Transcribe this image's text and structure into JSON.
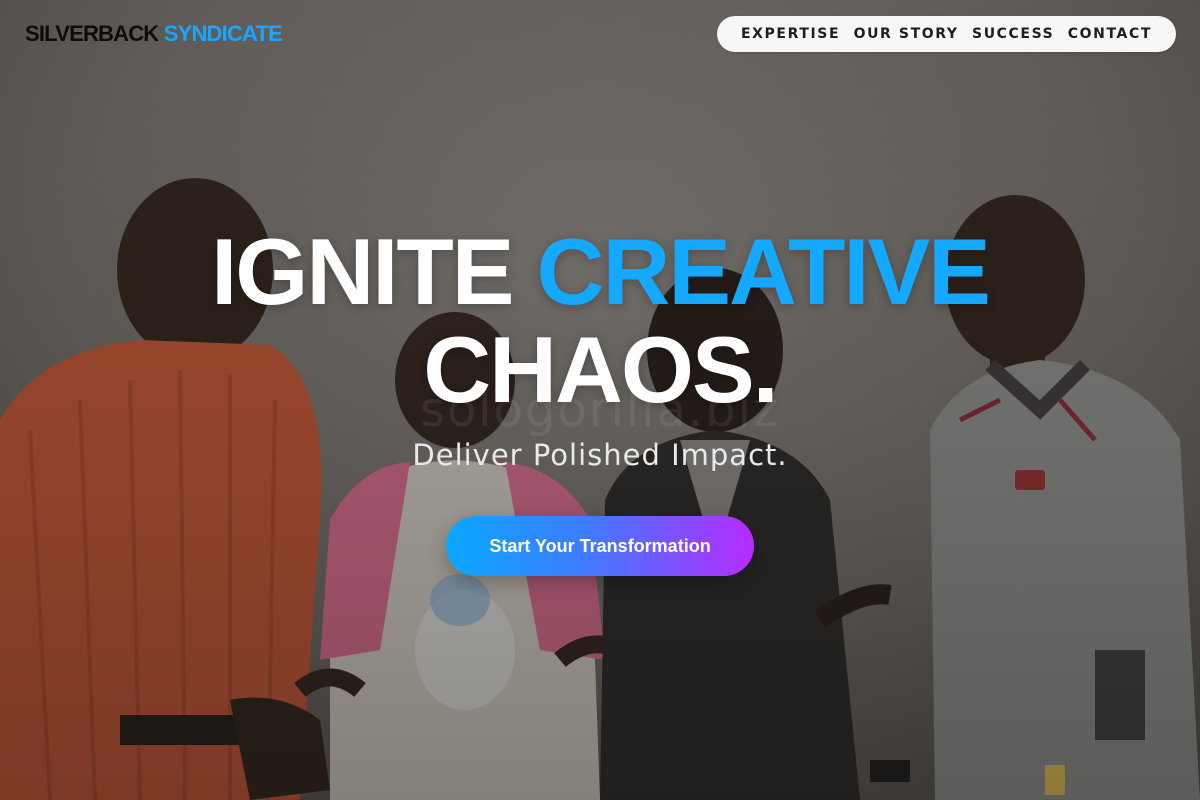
{
  "brand": {
    "part1": "SILVERBACK",
    "part2": "SYNDICATE"
  },
  "nav": {
    "items": [
      {
        "label": "EXPERTISE"
      },
      {
        "label": "OUR STORY"
      },
      {
        "label": "SUCCESS"
      },
      {
        "label": "CONTACT"
      }
    ]
  },
  "hero": {
    "headline_word1": "IGNITE",
    "headline_word2": "CREATIVE",
    "headline_line2": "CHAOS.",
    "subheadline": "Deliver Polished Impact.",
    "cta_label": "Start Your Transformation",
    "watermark": "sologorilla.biz",
    "background_image": "group-of-four-smiling-young-people-photo"
  },
  "colors": {
    "accent": "#14a9ff",
    "brand_dark": "#0d0d0d",
    "cta_gradient_start": "#0aa8ff",
    "cta_gradient_end": "#b62cff",
    "nav_background": "#f7f7f7"
  }
}
